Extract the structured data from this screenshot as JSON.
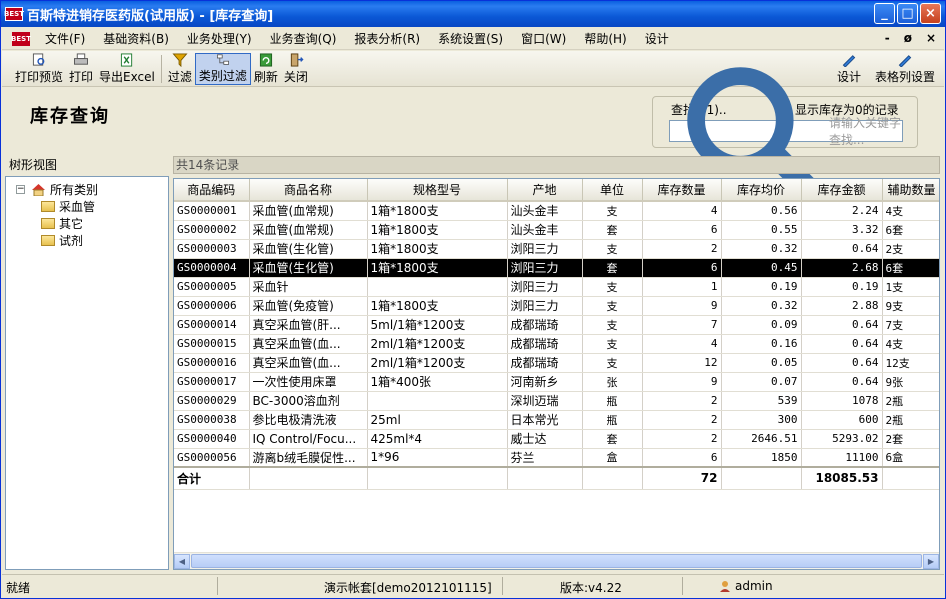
{
  "window": {
    "title": "百斯特进销存医药版(试用版) - [库存查询]",
    "logo_text": "BEST",
    "buttons": [
      "_",
      "□",
      "×"
    ]
  },
  "menu": {
    "items": [
      "文件(F)",
      "基础资料(B)",
      "业务处理(Y)",
      "业务查询(Q)",
      "报表分析(R)",
      "系统设置(S)",
      "窗口(W)",
      "帮助(H)",
      "设计"
    ],
    "right_buttons": [
      "-",
      "ø",
      "×"
    ]
  },
  "toolbar": {
    "buttons": [
      "打印预览",
      "打印",
      "导出Excel",
      "过滤",
      "类别过滤",
      "刷新",
      "关闭"
    ],
    "right_buttons": [
      "设计",
      "表格列设置"
    ]
  },
  "page": {
    "title": "库存查询",
    "search_label": "查找(F1)..",
    "show_zero_label": "显示库存为0的记录",
    "show_zero_checked": false,
    "search_placeholder": "请输入关键字查找..."
  },
  "tree": {
    "header": "树形视图",
    "root": "所有类别",
    "children": [
      "采血管",
      "其它",
      "试剂"
    ]
  },
  "grid": {
    "count_text": "共14条记录",
    "columns": [
      "商品编码",
      "商品名称",
      "规格型号",
      "产地",
      "单位",
      "库存数量",
      "库存均价",
      "库存金额",
      "辅助数量"
    ],
    "rows": [
      [
        "GS0000001",
        "采血管(血常规)",
        "1箱*1800支",
        "汕头金丰",
        "支",
        "4",
        "0.56",
        "2.24",
        "4支"
      ],
      [
        "GS0000002",
        "采血管(血常规)",
        "1箱*1800支",
        "汕头金丰",
        "套",
        "6",
        "0.55",
        "3.32",
        "6套"
      ],
      [
        "GS0000003",
        "采血管(生化管)",
        "1箱*1800支",
        "浏阳三力",
        "支",
        "2",
        "0.32",
        "0.64",
        "2支"
      ],
      [
        "GS0000004",
        "采血管(生化管)",
        "1箱*1800支",
        "浏阳三力",
        "套",
        "6",
        "0.45",
        "2.68",
        "6套"
      ],
      [
        "GS0000005",
        "采血针",
        "",
        "浏阳三力",
        "支",
        "1",
        "0.19",
        "0.19",
        "1支"
      ],
      [
        "GS0000006",
        "采血管(免疫管)",
        "1箱*1800支",
        "浏阳三力",
        "支",
        "9",
        "0.32",
        "2.88",
        "9支"
      ],
      [
        "GS0000014",
        "真空采血管(肝...",
        "5ml/1箱*1200支",
        "成都瑞琦",
        "支",
        "7",
        "0.09",
        "0.64",
        "7支"
      ],
      [
        "GS0000015",
        "真空采血管(血...",
        "2ml/1箱*1200支",
        "成都瑞琦",
        "支",
        "4",
        "0.16",
        "0.64",
        "4支"
      ],
      [
        "GS0000016",
        "真空采血管(血...",
        "2ml/1箱*1200支",
        "成都瑞琦",
        "支",
        "12",
        "0.05",
        "0.64",
        "12支"
      ],
      [
        "GS0000017",
        "一次性使用床罩",
        "1箱*400张",
        "河南新乡",
        "张",
        "9",
        "0.07",
        "0.64",
        "9张"
      ],
      [
        "GS0000029",
        "BC-3000溶血剂",
        "",
        "深圳迈瑞",
        "瓶",
        "2",
        "539",
        "1078",
        "2瓶"
      ],
      [
        "GS0000038",
        "参比电极清洗液",
        "25ml",
        "日本常光",
        "瓶",
        "2",
        "300",
        "600",
        "2瓶"
      ],
      [
        "GS0000040",
        "IQ Control/Focu...",
        "425ml*4",
        "威士达",
        "套",
        "2",
        "2646.51",
        "5293.02",
        "2套"
      ],
      [
        "GS0000056",
        "游离b绒毛膜促性...",
        "1*96",
        "芬兰",
        "盒",
        "6",
        "1850",
        "11100",
        "6盒"
      ]
    ],
    "selected_row": 3,
    "total_label": "合计",
    "total_qty": "72",
    "total_amount": "18085.53"
  },
  "status": {
    "ready": "就绪",
    "account": "演示帐套[demo2012101115]",
    "version": "版本:v4.22",
    "user": "admin"
  }
}
